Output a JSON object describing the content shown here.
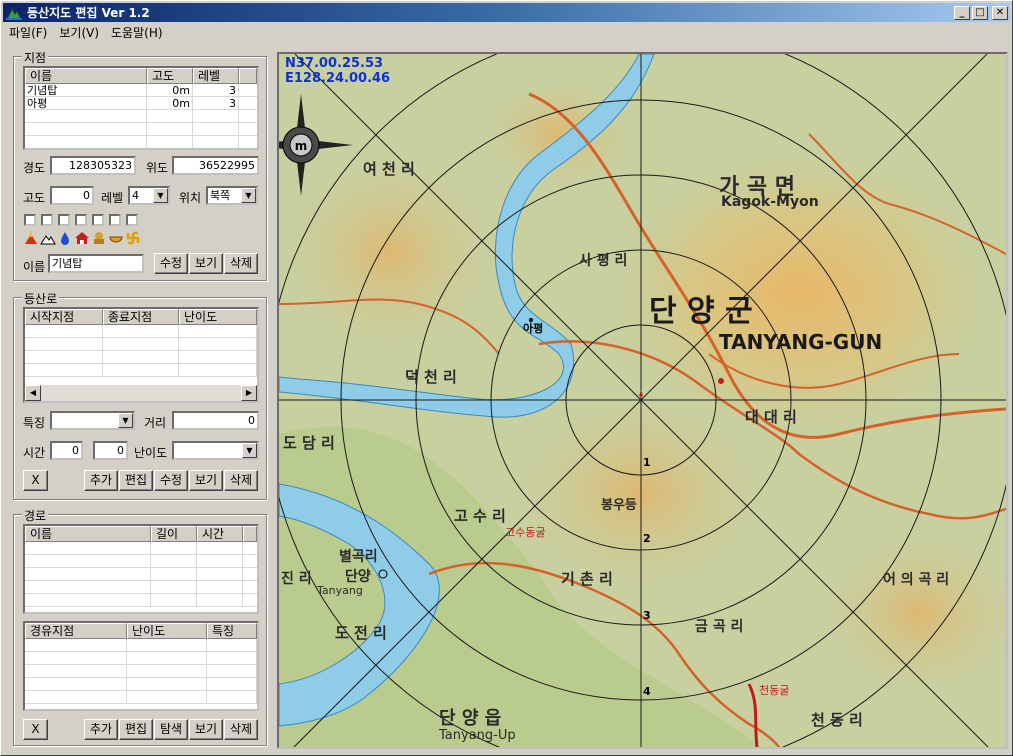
{
  "window": {
    "title": "등산지도 편집 Ver 1.2",
    "minimize": "_",
    "maximize": "□",
    "close": "✕"
  },
  "menu": [
    "파일(F)",
    "보기(V)",
    "도움말(H)"
  ],
  "points": {
    "group_label": "지점",
    "columns": [
      "이름",
      "고도",
      "레벨"
    ],
    "rows": [
      {
        "name": "기념탑",
        "alt": "0m",
        "level": "3"
      },
      {
        "name": "아평",
        "alt": "0m",
        "level": "3"
      }
    ],
    "longitude_label": "경도",
    "longitude_value": "128305323",
    "latitude_label": "위도",
    "latitude_value": "36522995",
    "altitude_label": "고도",
    "altitude_value": "0",
    "level_label": "레벨",
    "level_value": "4",
    "position_label": "위치",
    "position_value": "북쪽",
    "name_label": "이름",
    "name_value": "기념탑",
    "btn_edit": "수정",
    "btn_view": "보기",
    "btn_delete": "삭제"
  },
  "trails": {
    "group_label": "등산로",
    "columns": [
      "시작지점",
      "종료지점",
      "난이도"
    ],
    "feature_label": "특징",
    "distance_label": "거리",
    "distance_value": "0",
    "time_label": "시간",
    "time_h": "0",
    "time_m": "0",
    "difficulty_label": "난이도",
    "btn_x": "X",
    "btn_add": "추가",
    "btn_editmode": "편집",
    "btn_edit": "수정",
    "btn_view": "보기",
    "btn_delete": "삭제"
  },
  "routes": {
    "group_label": "경로",
    "columns": [
      "이름",
      "길이",
      "시간"
    ],
    "waypoint_columns": [
      "경유지점",
      "난이도",
      "특징"
    ],
    "btn_x": "X",
    "btn_add": "추가",
    "btn_editmode": "편집",
    "btn_search": "탐색",
    "btn_view": "보기",
    "btn_delete": "삭제"
  },
  "map": {
    "lat": "N37.00.25.53",
    "lon": "E128.24.00.46",
    "labels": {
      "gagok": "가 곡 면",
      "gagok_en": "Kagok-Myon",
      "danyang": "단   양   군",
      "danyang_en": "TANYANG-GUN",
      "sapyeong": "사 평 리",
      "yeocheon": "여 천 리",
      "deokcheon": "덕 천 리",
      "dodam": "도 담 리",
      "gosu": "고 수 리",
      "byeolgok": "별곡리",
      "danyang2": "단양",
      "tanyang": "Tanyang",
      "gichon": "기 촌 리",
      "daedae": "대 대 리",
      "bongudeung": "봉우등",
      "eoui": "어 의 곡 리",
      "jinri": "진 리",
      "dojeon": "도 전 리",
      "geumgok": "금 곡 리",
      "danyang_eup": "단 양 읍",
      "tanyang_up": "Tanyang-Up",
      "cheondong": "천 동 리",
      "apyeong": "아평",
      "gosudonggul": "고수동굴",
      "cheondonggul": "천동굴",
      "ring1": "1",
      "ring2": "2",
      "ring3": "3",
      "ring4": "4"
    }
  }
}
